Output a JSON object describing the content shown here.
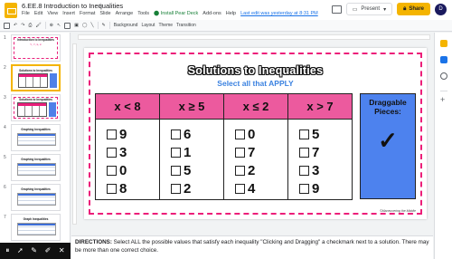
{
  "header": {
    "title": "6.EE.8  Introduction to Inequalities",
    "menu": [
      "File",
      "Edit",
      "View",
      "Insert",
      "Format",
      "Slide",
      "Arrange",
      "Tools"
    ],
    "addon_label": "Install Pear Deck",
    "menu_extra": [
      "Add-ons",
      "Help"
    ],
    "last_edit": "Last edit was yesterday at 8:31 PM",
    "present_label": "Present",
    "share_label": "Share",
    "avatar_initial": "D"
  },
  "toolbar": {
    "background_label": "Background",
    "layout_label": "Layout",
    "theme_label": "Theme",
    "transition_label": "Transition"
  },
  "filmstrip": {
    "slides": [
      {
        "number": "1",
        "title": "Introduction to Inequalities",
        "subtitle": "<, >, ≤, ≥"
      },
      {
        "number": "2",
        "title": "Solutions to Inequalities"
      },
      {
        "number": "3",
        "title": "Solutions to Inequalities"
      },
      {
        "number": "4",
        "title": "Graphing Inequalities"
      },
      {
        "number": "5",
        "title": "Graphing Inequalities"
      },
      {
        "number": "6",
        "title": "Graphing Inequalities"
      },
      {
        "number": "7",
        "title": "Graph Inequalities"
      }
    ],
    "active_index": 1
  },
  "slide": {
    "title": "Solutions to Inequalities",
    "subtitle": "Select all that APPLY",
    "columns": [
      {
        "header": "x < 8",
        "options": [
          "9",
          "3",
          "0",
          "8"
        ]
      },
      {
        "header": "x ≥ 5",
        "options": [
          "6",
          "1",
          "5",
          "2"
        ]
      },
      {
        "header": "x ≤ 2",
        "options": [
          "0",
          "7",
          "2",
          "4"
        ]
      },
      {
        "header": "x > 7",
        "options": [
          "5",
          "7",
          "3",
          "9"
        ]
      }
    ],
    "draggable_title": "Draggable Pieces:",
    "check_glyph": "✓",
    "credit": "©Maneuvering the Middle"
  },
  "notes": {
    "label": "DIRECTIONS:",
    "text": " Select ALL the possible values that satisfy each inequality \"Clicking and Dragging\" a checkmark next to a solution. There may be more than one correct choice."
  },
  "colors": {
    "accent_yellow": "#f4b400",
    "pink_header": "#ec5a9e",
    "pink_border": "#ec1e79",
    "drag_blue": "#4d82ee",
    "subtitle_blue": "#3b82e0"
  }
}
